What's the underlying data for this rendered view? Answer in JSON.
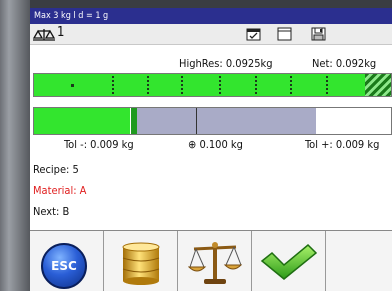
{
  "header": {
    "title": "Max 3 kg  l d = 1 g"
  },
  "status": {
    "scale_number": "1",
    "icons": [
      "calendar-icon",
      "document-icon",
      "save-icon"
    ]
  },
  "readout": {
    "highres_label": "HighRes:",
    "highres_value": "0.0925kg",
    "net_label": "Net:",
    "net_value": "0.092kg"
  },
  "weight_bar": {
    "fill_fraction": 0.93,
    "fill_color": "#33e52e"
  },
  "tolerance_bar": {
    "green_fraction": 0.27,
    "tol_minus_label": "Tol -: 0.009 kg",
    "target_label": "0.100 kg",
    "tol_plus_label": "Tol +: 0.009 kg",
    "green_color": "#33e52e",
    "band_color": "#a9abc7"
  },
  "recipe": {
    "recipe_label": "Recipe: 5",
    "material_label": "Material: A",
    "next_label": "Next: B",
    "material_color": "#e02020"
  },
  "softkeys": [
    {
      "name": "esc-button",
      "label": "ESC"
    },
    {
      "name": "database-button",
      "icon": "database-icon"
    },
    {
      "name": "balance-button",
      "icon": "balance-scale-icon"
    },
    {
      "name": "confirm-button",
      "icon": "checkmark-icon"
    }
  ]
}
